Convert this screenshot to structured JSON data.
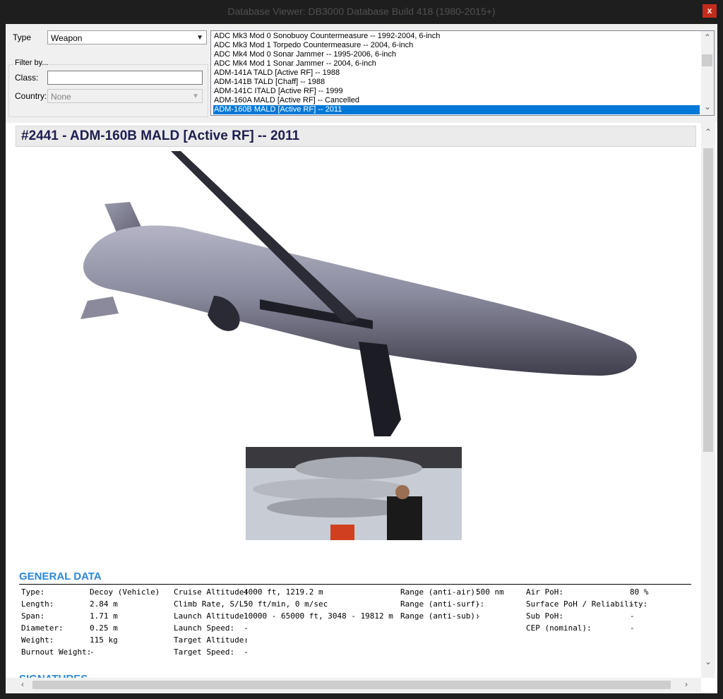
{
  "window": {
    "title": "Database Viewer: DB3000 Database Build 418 (1980-2015+)",
    "close_glyph": "x"
  },
  "filters": {
    "type_label": "Type",
    "type_value": "Weapon",
    "filter_group_label": "Filter by...",
    "class_label": "Class:",
    "class_value": "",
    "country_label": "Country:",
    "country_value": "None"
  },
  "list": {
    "items": [
      "ADC Mk3 Mod 0 Sonobuoy Countermeasure -- 1992-2004, 6-inch",
      "ADC Mk3 Mod 1 Torpedo Countermeasure -- 2004, 6-inch",
      "ADC Mk4 Mod 0 Sonar Jammer -- 1995-2006, 6-inch",
      "ADC Mk4 Mod 1 Sonar Jammer -- 2004, 6-inch",
      "ADM-141A TALD [Active RF] -- 1988",
      "ADM-141B TALD [Chaff] -- 1988",
      "ADM-141C ITALD [Active RF] -- 1999",
      "ADM-160A MALD [Active RF] -- Cancelled",
      "ADM-160B MALD [Active RF] -- 2011"
    ],
    "selected_index": 8
  },
  "record": {
    "heading": "#2441 - ADM-160B MALD [Active RF] -- 2011"
  },
  "general": {
    "title": "GENERAL DATA",
    "col1": [
      {
        "label": "Type:",
        "value": "Decoy (Vehicle)"
      },
      {
        "label": "Length:",
        "value": "2.84 m"
      },
      {
        "label": "Span:",
        "value": "1.71 m"
      },
      {
        "label": "Diameter:",
        "value": "0.25 m"
      },
      {
        "label": "Weight:",
        "value": "115 kg"
      },
      {
        "label": "Burnout Weight:",
        "value": "-"
      }
    ],
    "col2": [
      {
        "label": "Cruise Altitude:",
        "value": "4000 ft, 1219.2 m"
      },
      {
        "label": "Climb Rate, S/L:",
        "value": "50 ft/min, 0 m/sec"
      },
      {
        "label": "Launch Altitude:",
        "value": "10000 - 65000 ft, 3048 - 19812 m"
      },
      {
        "label": "Launch Speed:",
        "value": "-"
      },
      {
        "label": "Target Altitude:",
        "value": "-"
      },
      {
        "label": "Target Speed:",
        "value": "-"
      }
    ],
    "col3": [
      {
        "label": "Range (anti-air):",
        "value": "500 nm"
      },
      {
        "label": "Range (anti-surf):",
        "value": "-"
      },
      {
        "label": "Range (anti-sub):",
        "value": "-"
      }
    ],
    "col4": [
      {
        "label": "Air PoH:",
        "value": "80 %"
      },
      {
        "label": "Surface PoH / Reliability:",
        "value": "-"
      },
      {
        "label": "Sub PoH:",
        "value": "-"
      },
      {
        "label": "CEP (nominal):",
        "value": "-"
      }
    ]
  },
  "signatures": {
    "title": "SIGNATURES"
  },
  "icons": [
    "close-icon",
    "chevron-down-icon",
    "scroll-up-icon",
    "scroll-down-icon",
    "scroll-left-icon",
    "scroll-right-icon"
  ]
}
